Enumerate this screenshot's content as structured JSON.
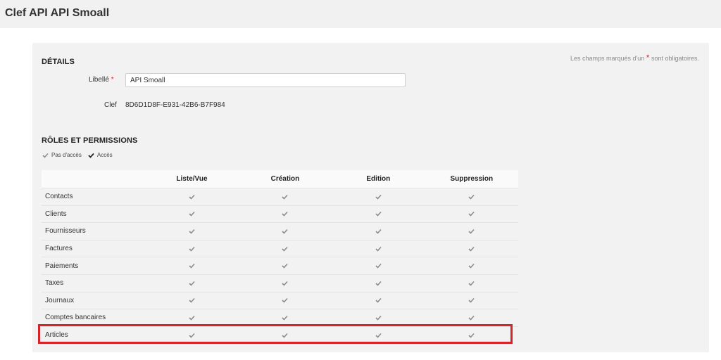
{
  "header": {
    "title": "Clef API API Smoall"
  },
  "form": {
    "required_note_prefix": "Les champs marqués d'un",
    "required_note_star": "*",
    "required_note_suffix": "sont obligatoires.",
    "details_title": "DÉTAILS",
    "label_field_label": "Libellé",
    "label_field_star": "*",
    "label_field_value": "API Smoall",
    "key_label": "Clef",
    "key_value": "8D6D1D8F-E931-42B6-B7F984"
  },
  "roles": {
    "title": "RÔLES ET PERMISSIONS",
    "legend_no_access": "Pas d'accès",
    "legend_access": "Accès",
    "columns": [
      "Liste/Vue",
      "Création",
      "Edition",
      "Suppression"
    ],
    "rows": [
      {
        "name": "Contacts"
      },
      {
        "name": "Clients"
      },
      {
        "name": "Fournisseurs"
      },
      {
        "name": "Factures"
      },
      {
        "name": "Paiements"
      },
      {
        "name": "Taxes"
      },
      {
        "name": "Journaux"
      },
      {
        "name": "Comptes bancaires"
      },
      {
        "name": "Articles"
      }
    ],
    "highlighted_row": "Articles"
  },
  "colors": {
    "highlight": "#d7232a",
    "check_inactive": "#8c8c8c",
    "check_active": "#222222"
  }
}
